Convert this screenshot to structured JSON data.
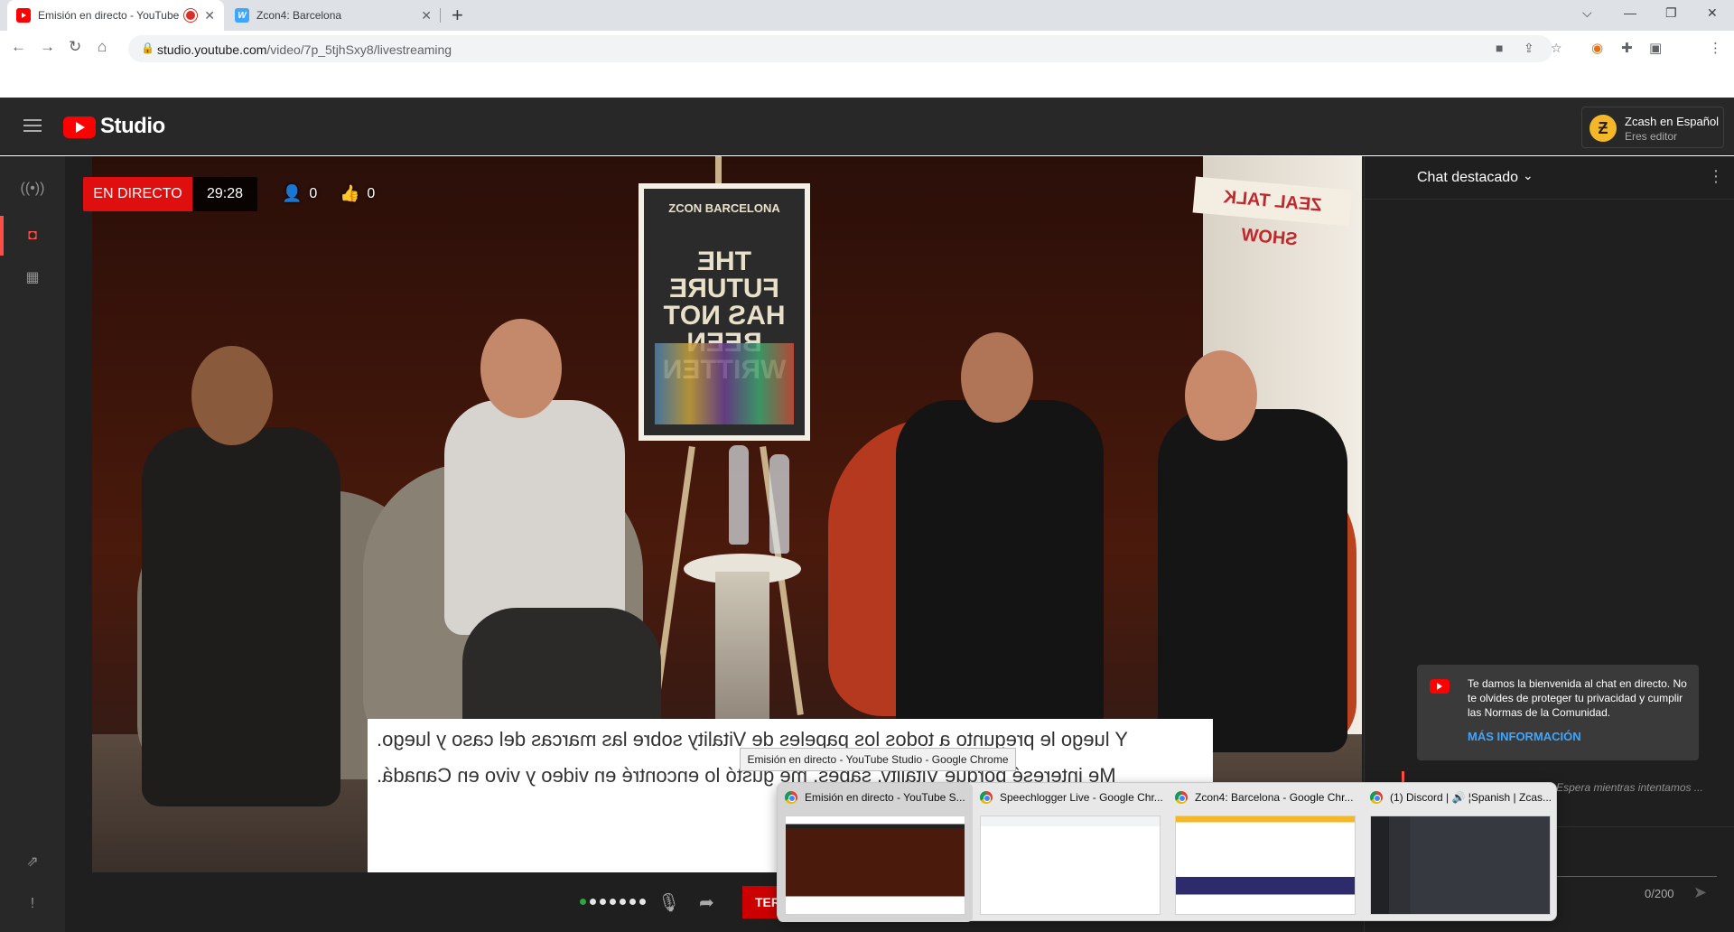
{
  "browser": {
    "tabs": [
      {
        "title": "Emisión en directo - YouTube Studio",
        "active": true
      },
      {
        "title": "Zcon4: Barcelona",
        "active": false
      }
    ],
    "new_tab": "+",
    "url": {
      "host": "studio.youtube.com",
      "path": "/video/7p_5tjhSxy8/livestreaming"
    }
  },
  "studio": {
    "logo_text": "Studio",
    "channel": {
      "initial": "Ƶ",
      "name": "Zcash en Español",
      "role": "Eres editor"
    }
  },
  "stream": {
    "live_label": "EN DIRECTO",
    "elapsed": "29:28",
    "viewers": "0",
    "likes": "0",
    "end_button": "TER",
    "poster": {
      "brand": "ZCON BARCELONA",
      "text": "THE FUTURE HAS NOT BEEN WRITTEN"
    },
    "banner": "ZEAL TALK SHOW",
    "captions": [
      "Y luego le pregunto a todos los papeles de Vitality sobre las marcas del caso y luego.",
      "Me interesé porque Vitality, sabes, me gustó lo encontré en video y vivo en Canadá."
    ]
  },
  "chat": {
    "title": "Chat destacado",
    "welcome_text": "Te damos la bienvenida al chat en directo. No te olvides de proteger tu privacidad y cumplir las Normas de la Comunidad.",
    "welcome_link": "MÁS INFORMACIÓN",
    "disconnected": "El chat se ha desconectado. Espera mientras intentamos ... ente.",
    "counter": "0/200"
  },
  "taskbar": {
    "tooltip": "Emisión en directo - YouTube Studio - Google Chrome",
    "previews": [
      {
        "title": "Emisión en directo - YouTube S..."
      },
      {
        "title": "Speechlogger Live - Google Chr..."
      },
      {
        "title": "Zcon4: Barcelona - Google Chr..."
      },
      {
        "title": "(1) Discord | 🔊 ¦Spanish | Zcas..."
      }
    ]
  },
  "colors": {
    "accent_red": "#ff0000",
    "live_red": "#e00f0f",
    "link_blue": "#3ea6ff",
    "dark_bg": "#282828"
  }
}
